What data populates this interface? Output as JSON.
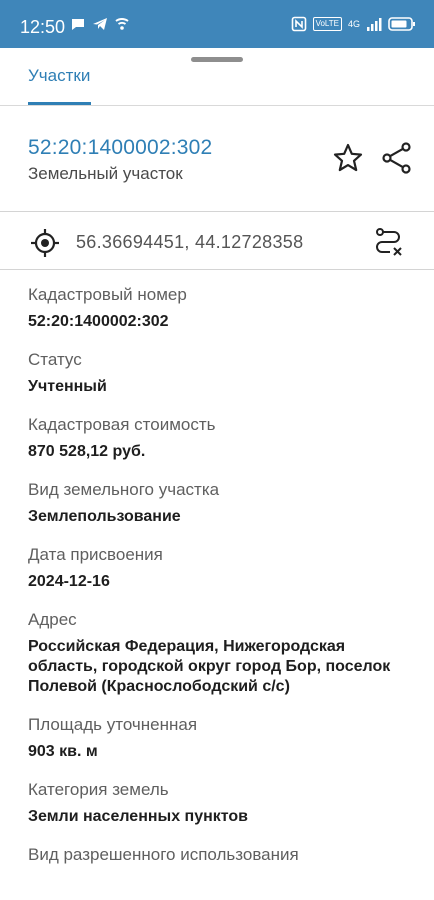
{
  "status_bar": {
    "time": "12:50",
    "left_icons": [
      "chat-icon",
      "telegram-icon",
      "wifi-icon"
    ],
    "right_icons": [
      "nfc-icon",
      "volte-icon",
      "signal-icon",
      "battery-icon"
    ],
    "network": "4G",
    "volte": "VoLTE"
  },
  "tabs": [
    {
      "label": "Участки",
      "active": true
    }
  ],
  "parcel": {
    "cadastral_title": "52:20:1400002:302",
    "subtitle": "Земельный участок"
  },
  "coordinates": {
    "text": "56.36694451, 44.12728358"
  },
  "fields": [
    {
      "label": "Кадастровый номер",
      "value": "52:20:1400002:302"
    },
    {
      "label": "Статус",
      "value": "Учтенный"
    },
    {
      "label": "Кадастровая стоимость",
      "value": "870 528,12 руб."
    },
    {
      "label": "Вид земельного участка",
      "value": "Землепользование"
    },
    {
      "label": "Дата присвоения",
      "value": "2024-12-16"
    },
    {
      "label": "Адрес",
      "value": "Российская Федерация, Нижегородская область, городской округ город Бор, поселок Полевой (Краснослободский с/с)"
    },
    {
      "label": "Площадь уточненная",
      "value": "903 кв. м"
    },
    {
      "label": "Категория земель",
      "value": "Земли населенных пунктов"
    },
    {
      "label": "Вид разрешенного использования",
      "value": ""
    }
  ],
  "colors": {
    "status_bar": "#3f86ba",
    "accent": "#2f7fb5"
  }
}
